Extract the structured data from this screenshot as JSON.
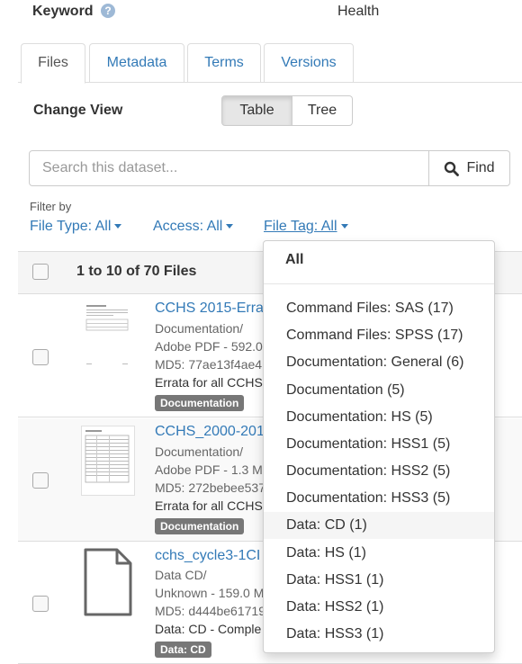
{
  "keyword": {
    "label": "Keyword",
    "help": "?",
    "value": "Health"
  },
  "tabs": [
    {
      "label": "Files"
    },
    {
      "label": "Metadata"
    },
    {
      "label": "Terms"
    },
    {
      "label": "Versions"
    }
  ],
  "view": {
    "label": "Change View",
    "table": "Table",
    "tree": "Tree"
  },
  "search": {
    "placeholder": "Search this dataset...",
    "button": "Find"
  },
  "filters": {
    "label": "Filter by",
    "file_type": "File Type: All",
    "access": "Access: All",
    "file_tag": "File Tag: All"
  },
  "table": {
    "count": "1 to 10 of 70 Files",
    "rows": [
      {
        "title": "CCHS 2015-Erra",
        "type": "Documentation/",
        "info": "Adobe PDF - 592.0",
        "md5": "MD5: 77ae13f4ae4",
        "desc": "Errata for all CCHS",
        "tag": "Documentation"
      },
      {
        "title": "CCHS_2000-201",
        "type": "Documentation/",
        "info": "Adobe PDF - 1.3 M",
        "md5": "MD5: 272bebee537",
        "desc": "Errata for all CCHS",
        "tag": "Documentation"
      },
      {
        "title": "cchs_cycle3-1CI",
        "type": "Data CD/",
        "info": "Unknown - 159.0 M",
        "md5": "MD5: d444be61719",
        "desc": "Data: CD - Comple",
        "tag": "Data: CD"
      }
    ]
  },
  "dropdown": {
    "header": "All",
    "items": [
      "Command Files: SAS (17)",
      "Command Files: SPSS (17)",
      "Documentation: General (6)",
      "Documentation (5)",
      "Documentation: HS (5)",
      "Documentation: HSS1 (5)",
      "Documentation: HSS2 (5)",
      "Documentation: HSS3 (5)",
      "Data: CD (1)",
      "Data: HS (1)",
      "Data: HSS1 (1)",
      "Data: HSS2 (1)",
      "Data: HSS3 (1)"
    ],
    "highlighted_item": "Data: CD (1)"
  },
  "colors": {
    "link": "#337ab7",
    "tag_bg": "#777777",
    "border": "#dddddd"
  }
}
